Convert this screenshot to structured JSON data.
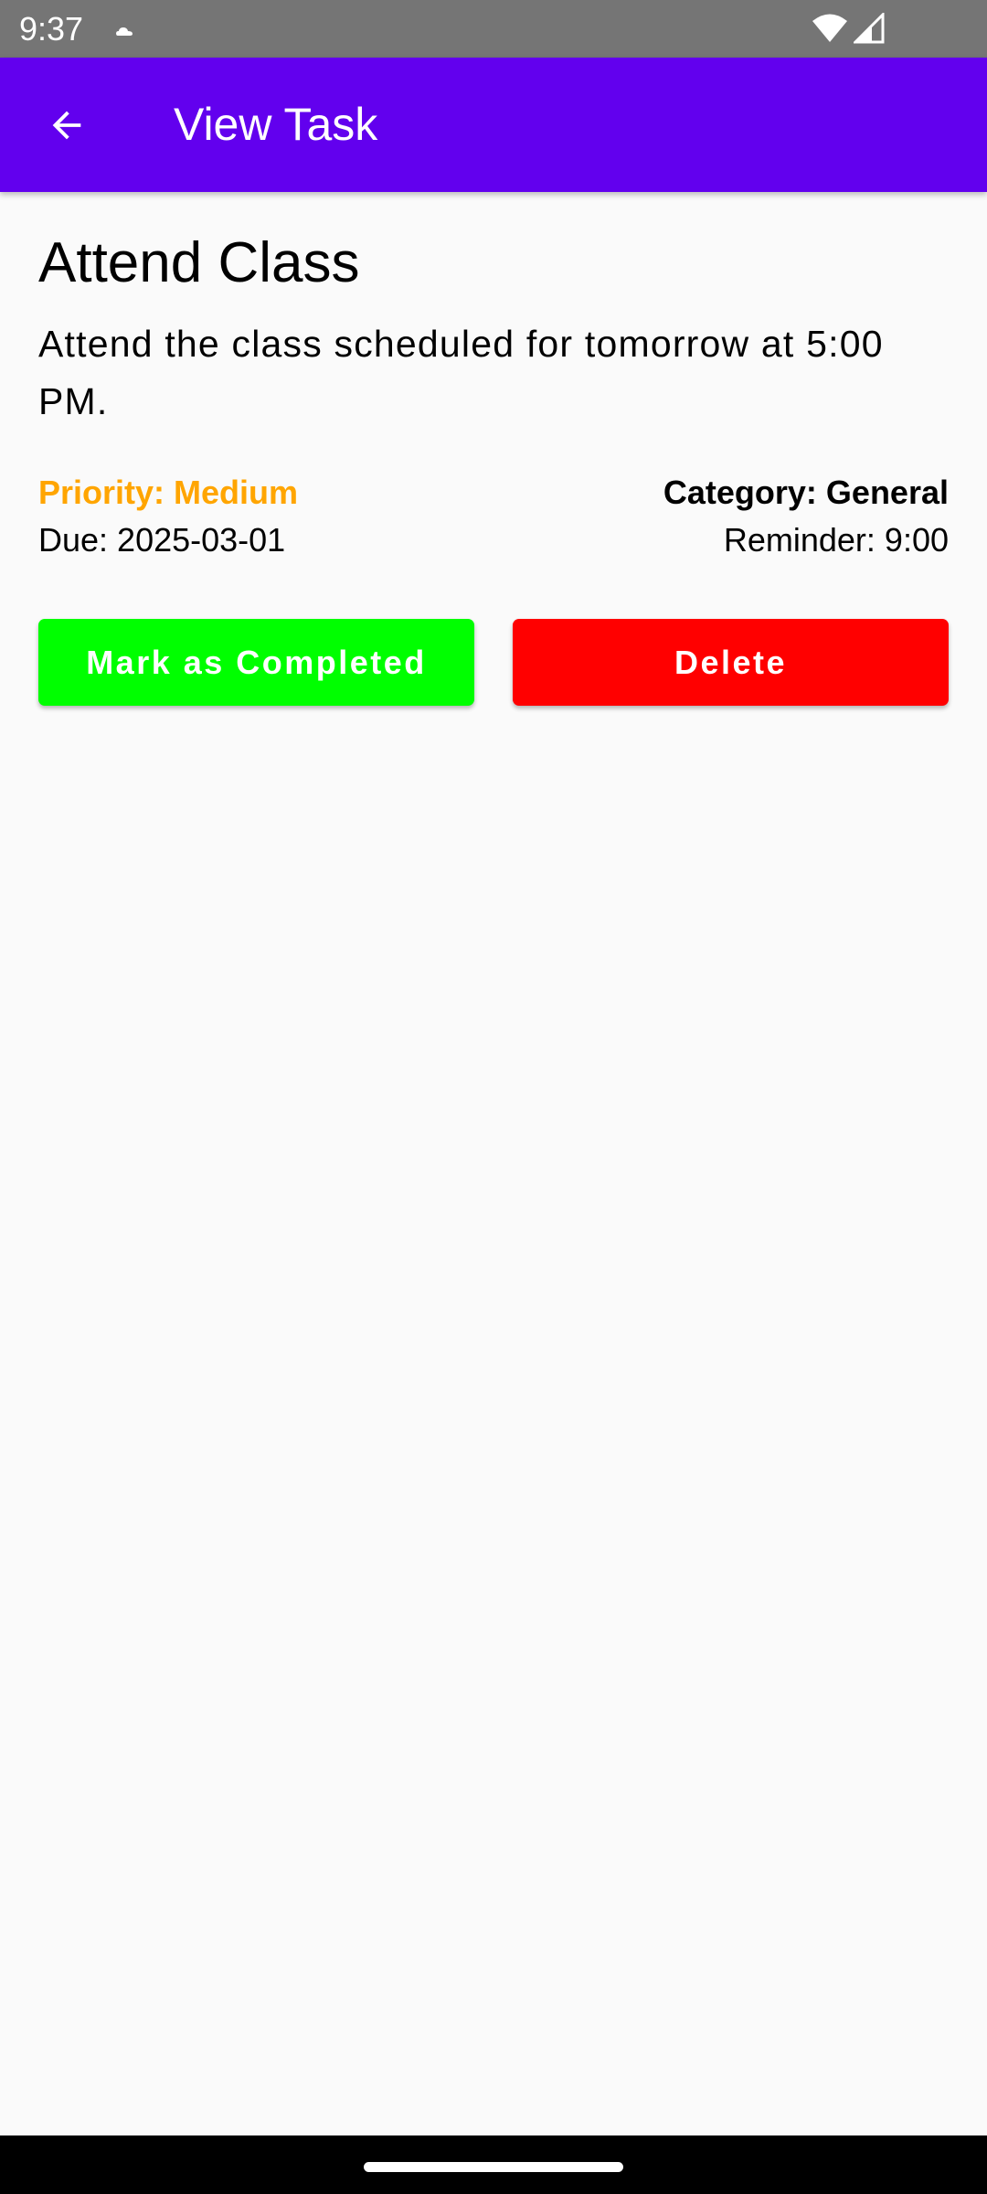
{
  "status_bar": {
    "time": "9:37",
    "notification_icon": "cloud-icon",
    "wifi_icon": "wifi-icon",
    "signal_icon": "cell-signal-icon"
  },
  "app_bar": {
    "title": "View Task",
    "back_icon": "arrow-back-icon",
    "background_color": "#6200ee"
  },
  "task": {
    "title": "Attend Class",
    "description": "Attend the class scheduled for tomorrow at 5:00 PM.",
    "priority": "Priority: Medium",
    "priority_color": "#ffa500",
    "due": "Due: 2025-03-01",
    "category": "Category: General",
    "reminder": "Reminder: 9:00"
  },
  "actions": {
    "complete_label": "Mark as Completed",
    "complete_color": "#00ff00",
    "delete_label": "Delete",
    "delete_color": "#ff0000"
  },
  "nav_bar": {
    "home_handle": "home-gesture-handle"
  }
}
